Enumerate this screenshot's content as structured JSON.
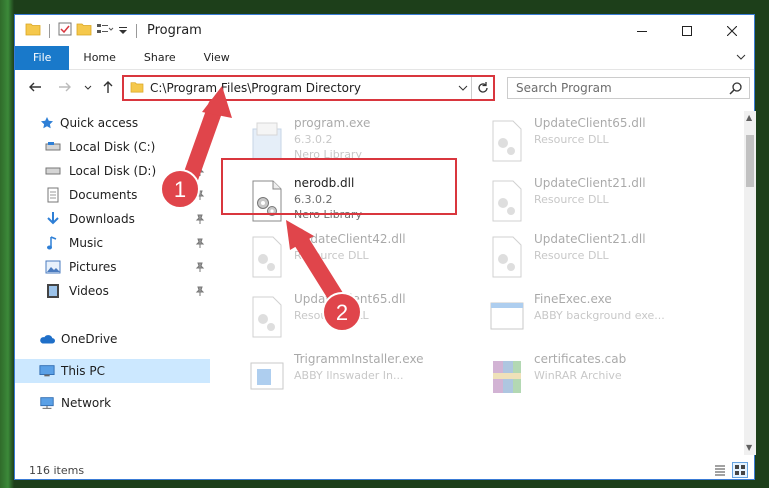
{
  "window": {
    "title": "Program",
    "controls": [
      "minimize-icon",
      "maximize-icon",
      "close-icon"
    ]
  },
  "ribbon": {
    "tabs": [
      {
        "label": "File"
      },
      {
        "label": "Home"
      },
      {
        "label": "Share"
      },
      {
        "label": "View"
      }
    ]
  },
  "address": {
    "path": "C:\\Program Files\\Program Directory"
  },
  "search": {
    "placeholder": "Search Program"
  },
  "nav": {
    "items": [
      {
        "label": "Quick access",
        "icon": "star-icon"
      },
      {
        "label": "Local Disk (C:)",
        "icon": "drive-icon"
      },
      {
        "label": "Local Disk (D:)",
        "icon": "drive-icon"
      },
      {
        "label": "Documents",
        "icon": "documents-icon"
      },
      {
        "label": "Downloads",
        "icon": "download-icon"
      },
      {
        "label": "Music",
        "icon": "music-icon"
      },
      {
        "label": "Pictures",
        "icon": "pictures-icon"
      },
      {
        "label": "Videos",
        "icon": "videos-icon"
      },
      {
        "label": "OneDrive",
        "icon": "cloud-icon"
      },
      {
        "label": "This PC",
        "icon": "computer-icon"
      },
      {
        "label": "Network",
        "icon": "network-icon"
      }
    ]
  },
  "files": [
    {
      "name": "program.exe",
      "line2": "6.3.0.2",
      "line3": "Nero Library",
      "icon": "installer-icon"
    },
    {
      "name": "UpdateClient65.dll",
      "line2": "Resource DLL",
      "line3": "",
      "icon": "dll-icon"
    },
    {
      "name": "nerodb.dll",
      "line2": "6.3.0.2",
      "line3": "Nero Library",
      "icon": "dll-gears-icon"
    },
    {
      "name": "UpdateClient21.dll",
      "line2": "Resource DLL",
      "line3": "",
      "icon": "dll-icon"
    },
    {
      "name": "UpdateClient42.dll",
      "line2": "Resource DLL",
      "line3": "",
      "icon": "dll-icon"
    },
    {
      "name": "UpdateClient21.dll",
      "line2": "Resource DLL",
      "line3": "",
      "icon": "dll-icon"
    },
    {
      "name": "UpdateClient65.dll",
      "line2": "Resource DLL",
      "line3": "",
      "icon": "dll-icon"
    },
    {
      "name": "FineExec.exe",
      "line2": "ABBY background exe...",
      "line3": "",
      "icon": "exe-icon"
    },
    {
      "name": "TrigrammInstaller.exe",
      "line2": "ABBY Ilnswader In...",
      "line3": "",
      "icon": "exe-icon"
    },
    {
      "name": "certificates.cab",
      "line2": "WinRAR Archive",
      "line3": "",
      "icon": "archive-icon"
    }
  ],
  "status": {
    "item_count": "116 items"
  },
  "annotations": {
    "badge1": "1",
    "badge2": "2",
    "color": "#d9363e"
  }
}
